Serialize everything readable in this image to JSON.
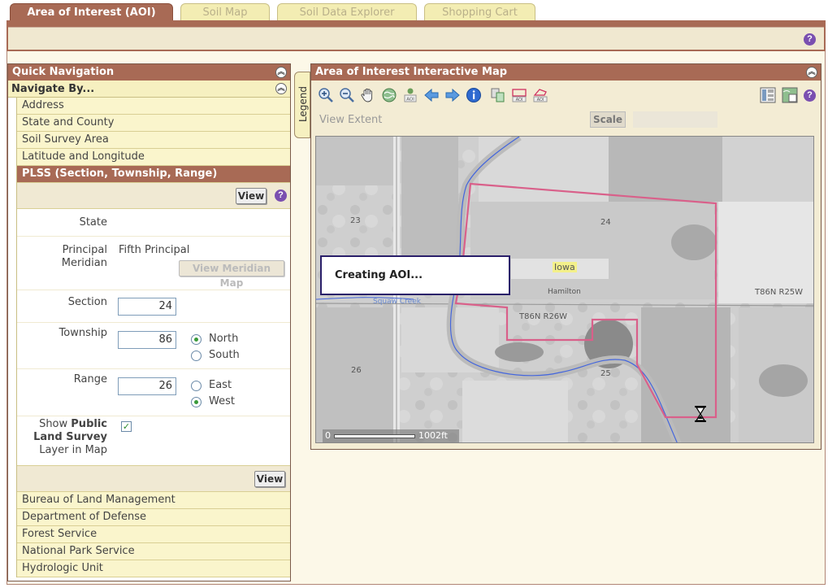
{
  "tabs": [
    {
      "label": "Area of Interest (AOI)",
      "active": true
    },
    {
      "label": "Soil Map",
      "active": false
    },
    {
      "label": "Soil Data Explorer",
      "active": false
    },
    {
      "label": "Shopping Cart",
      "active": false
    }
  ],
  "quick_nav": {
    "title": "Quick Navigation",
    "navigate_by": "Navigate By...",
    "items_top": [
      "Address",
      "State and County",
      "Soil Survey Area",
      "Latitude and Longitude"
    ],
    "active_item": "PLSS (Section, Township, Range)",
    "items_bottom": [
      "Bureau of Land Management",
      "Department of Defense",
      "Forest Service",
      "National Park Service",
      "Hydrologic Unit"
    ]
  },
  "plss": {
    "view_label": "View",
    "state_label": "State",
    "state_value": "",
    "meridian_label_1": "Principal",
    "meridian_label_2": "Meridian",
    "meridian_value": "Fifth Principal",
    "view_meridian_map": "View Meridian Map",
    "section_label": "Section",
    "section_value": "24",
    "township_label": "Township",
    "township_value": "86",
    "north_label": "North",
    "south_label": "South",
    "township_direction": "North",
    "range_label": "Range",
    "range_value": "26",
    "east_label": "East",
    "west_label": "West",
    "range_direction": "West",
    "show_prefix": "Show",
    "show_bold_1": "Public",
    "show_bold_2": "Land Survey",
    "show_suffix": "Layer in Map",
    "show_checked": true
  },
  "legend_label": "Legend",
  "map_panel": {
    "title": "Area of Interest Interactive Map",
    "view_extent": "View Extent",
    "scale_label": "Scale",
    "tool_aoi": "AOI",
    "dialog_text": "Creating AOI...",
    "labels": {
      "sec23": "23",
      "sec24": "24",
      "sec26": "26",
      "sec25": "25",
      "iowa": "Iowa",
      "hamilton": "Hamilton",
      "t86r26": "T86N R26W",
      "t86r25": "T86N R25W",
      "creek": "Squaw Creek"
    },
    "scale_zero": "0",
    "scale_distance": "1002ft"
  },
  "help_glyph": "?",
  "collapse_glyph": "︽",
  "check_glyph": "✓",
  "colors": {
    "brand": "#a86a55",
    "nav_bg": "#faf5cc",
    "aoi_outline": "#d9608a",
    "water": "#4466dd"
  }
}
